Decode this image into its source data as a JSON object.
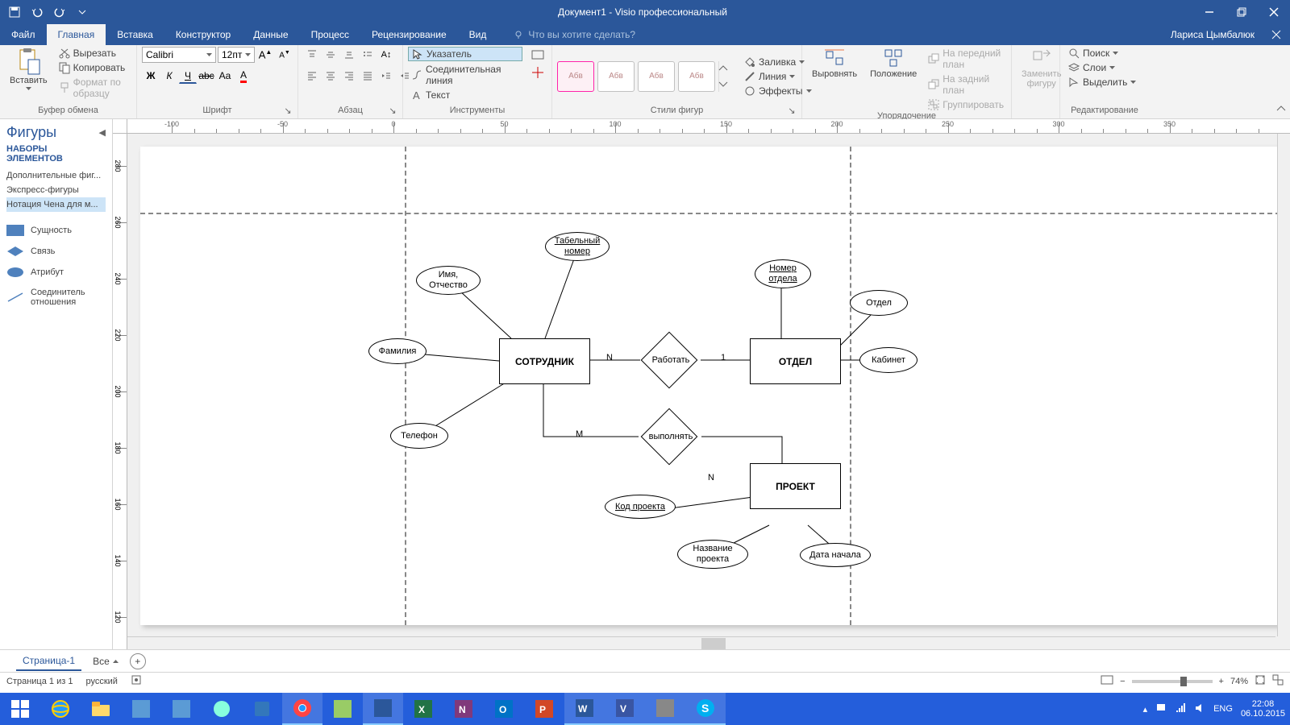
{
  "titlebar": {
    "title": "Документ1 - Visio профессиональный",
    "user": "Лариса Цымбалюк"
  },
  "tabs": {
    "file": "Файл",
    "home": "Главная",
    "insert": "Вставка",
    "design": "Конструктор",
    "data": "Данные",
    "process": "Процесс",
    "review": "Рецензирование",
    "view": "Вид",
    "tellme": "Что вы хотите сделать?"
  },
  "ribbon": {
    "clipboard": {
      "paste": "Вставить",
      "cut": "Вырезать",
      "copy": "Копировать",
      "format_painter": "Формат по образцу",
      "label": "Буфер обмена"
    },
    "font": {
      "name": "Calibri",
      "size": "12пт",
      "label": "Шрифт"
    },
    "paragraph": {
      "label": "Абзац"
    },
    "tools": {
      "pointer": "Указатель",
      "connector": "Соединительная линия",
      "text": "Текст",
      "label": "Инструменты"
    },
    "styles": {
      "item": "Абв",
      "label": "Стили фигур"
    },
    "shape_fx": {
      "fill": "Заливка",
      "line": "Линия",
      "effects": "Эффекты"
    },
    "arrange": {
      "align": "Выровнять",
      "position": "Положение",
      "bring_front": "На передний план",
      "send_back": "На задний план",
      "group": "Группировать",
      "label": "Упорядочение"
    },
    "change_shape": {
      "label": "Заменить фигуру"
    },
    "editing": {
      "find": "Поиск",
      "layers": "Слои",
      "select": "Выделить",
      "label": "Редактирование"
    }
  },
  "shapes_pane": {
    "title": "Фигуры",
    "subtitle": "НАБОРЫ ЭЛЕМЕНТОВ",
    "stencils": {
      "more": "Дополнительные фиг...",
      "express": "Экспресс-фигуры",
      "chen": "Нотация Чена для м..."
    },
    "masters": {
      "entity": "Сущность",
      "relationship": "Связь",
      "attribute": "Атрибут",
      "connector": "Соединитель отношения"
    }
  },
  "diagram": {
    "entities": {
      "employee": "СОТРУДНИК",
      "department": "ОТДЕЛ",
      "project": "ПРОЕКТ"
    },
    "relationships": {
      "work": "Работать",
      "perform": "выполнять"
    },
    "cardinality": {
      "N": "N",
      "one": "1",
      "M": "M"
    },
    "attributes": {
      "emp_no": "Табельный номер",
      "name_patr": "Имя, Отчество",
      "surname": "Фамилия",
      "phone": "Телефон",
      "dept_no": "Номер отдела",
      "dept": "Отдел",
      "office": "Кабинет",
      "proj_code": "Код проекта",
      "proj_name": "Название проекта",
      "start_date": "Дата начала"
    }
  },
  "ruler_h": [
    "-100",
    "-50",
    "0",
    "50",
    "100",
    "150",
    "200",
    "250",
    "300",
    "350"
  ],
  "ruler_v": [
    "280",
    "260",
    "240",
    "220",
    "200",
    "180",
    "160",
    "140",
    "120"
  ],
  "page_tabs": {
    "page1": "Страница-1",
    "all": "Все"
  },
  "statusbar": {
    "page": "Страница 1 из 1",
    "lang": "русский",
    "zoom": "74%"
  },
  "tray": {
    "lang": "ENG",
    "time": "22:08",
    "date": "06.10.2015"
  }
}
